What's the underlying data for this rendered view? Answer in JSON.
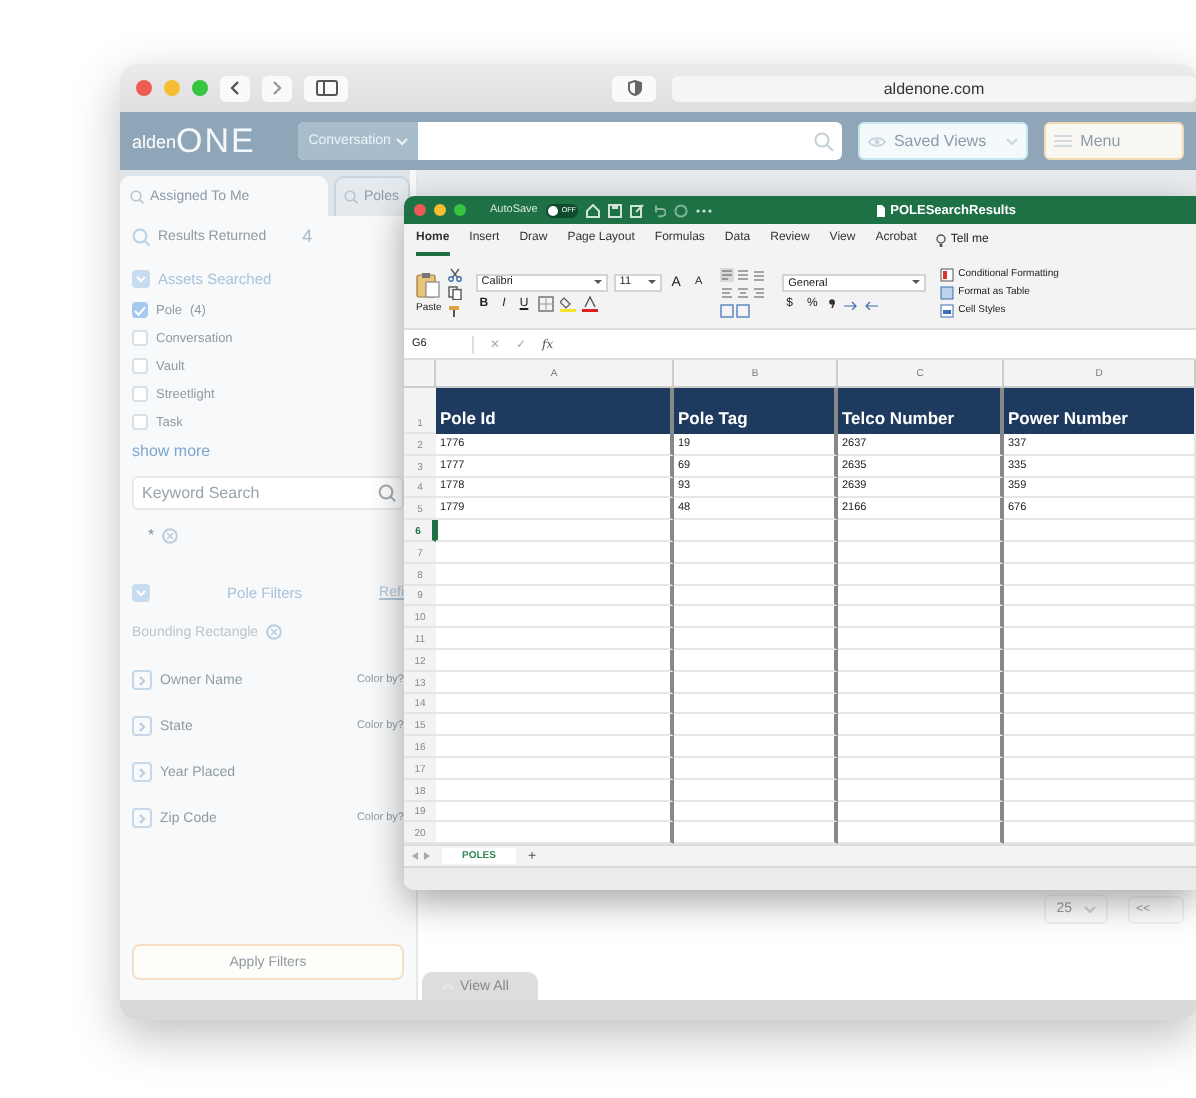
{
  "browser": {
    "address": "aldenone.com"
  },
  "app": {
    "logo": {
      "prefix": "alden",
      "suffix": "ONE"
    },
    "search_category": "Conversation",
    "saved_views": "Saved Views",
    "menu": "Menu"
  },
  "tabs": [
    {
      "label": "Assigned To Me",
      "selected": true
    },
    {
      "label": "Poles",
      "selected": false
    }
  ],
  "sidebar": {
    "results": {
      "label": "Results Returned",
      "count": "4"
    },
    "assets": {
      "title": "Assets Searched",
      "expanded": true,
      "items": [
        {
          "label": "Pole",
          "count": "(4)",
          "checked": true
        },
        {
          "label": "Conversation",
          "checked": false
        },
        {
          "label": "Vault",
          "checked": false
        },
        {
          "label": "Streetlight",
          "checked": false
        },
        {
          "label": "Task",
          "checked": false
        }
      ],
      "more": "show more"
    },
    "keyword_search": {
      "placeholder": "Keyword Search"
    },
    "chips": [
      "*"
    ],
    "pole_filters": {
      "title": "Pole Filters",
      "expanded": true,
      "link": "Refi",
      "bounding": "Bounding Rectangle",
      "filters": [
        {
          "label": "Owner Name",
          "color_by": "Color by?"
        },
        {
          "label": "State",
          "color_by": "Color by?"
        },
        {
          "label": "Year Placed"
        },
        {
          "label": "Zip Code",
          "color_by": "Color by?"
        }
      ]
    },
    "apply": "Apply Filters"
  },
  "main": {
    "page_size": "25",
    "first_page": "<<",
    "view_all": "View All"
  },
  "excel": {
    "title": "POLESearchResults",
    "autosave": {
      "label": "AutoSave",
      "on": false,
      "state_text": "OFF"
    },
    "ribbon_tabs": [
      {
        "label": "Home",
        "selected": true
      },
      {
        "label": "Insert",
        "selected": false
      },
      {
        "label": "Draw",
        "selected": false
      },
      {
        "label": "Page Layout",
        "selected": false
      },
      {
        "label": "Formulas",
        "selected": false
      },
      {
        "label": "Data",
        "selected": false
      },
      {
        "label": "Review",
        "selected": false
      },
      {
        "label": "View",
        "selected": false
      },
      {
        "label": "Acrobat",
        "selected": false
      }
    ],
    "tell_me": "Tell me",
    "paste": "Paste",
    "font": "Calibri",
    "font_size": "11",
    "size_buttons": [
      "A",
      "A"
    ],
    "font_buttons": [
      "B",
      "I",
      "U"
    ],
    "number_format": "General",
    "number_buttons": [
      "$",
      "%"
    ],
    "styles": [
      "Conditional Formatting",
      "Format as Table",
      "Cell Styles"
    ],
    "name_box": "G6",
    "formula_buttons": [
      "✕",
      "✓"
    ],
    "formula_label": "fx",
    "columns": [
      "A",
      "B",
      "C",
      "D"
    ],
    "header": [
      "Pole Id",
      "Pole Tag",
      "Telco Number",
      "Power Number"
    ],
    "rows": [
      [
        "1776",
        "19",
        "2637",
        "337"
      ],
      [
        "1777",
        "69",
        "2635",
        "335"
      ],
      [
        "1778",
        "93",
        "2639",
        "359"
      ],
      [
        "1779",
        "48",
        "2166",
        "676"
      ]
    ],
    "row_headers": [
      {
        "label": "1",
        "selected": false
      },
      {
        "label": "2",
        "selected": false
      },
      {
        "label": "3",
        "selected": false
      },
      {
        "label": "4",
        "selected": false
      },
      {
        "label": "5",
        "selected": false
      },
      {
        "label": "6",
        "selected": true
      },
      {
        "label": "7",
        "selected": false
      },
      {
        "label": "8",
        "selected": false
      },
      {
        "label": "9",
        "selected": false
      },
      {
        "label": "10",
        "selected": false
      },
      {
        "label": "11",
        "selected": false
      },
      {
        "label": "12",
        "selected": false
      },
      {
        "label": "13",
        "selected": false
      },
      {
        "label": "14",
        "selected": false
      },
      {
        "label": "15",
        "selected": false
      },
      {
        "label": "16",
        "selected": false
      },
      {
        "label": "17",
        "selected": false
      },
      {
        "label": "18",
        "selected": false
      },
      {
        "label": "19",
        "selected": false
      },
      {
        "label": "20",
        "selected": false
      }
    ],
    "sheets": [
      {
        "label": "POLES",
        "selected": true
      }
    ],
    "add_sheet": "+"
  }
}
